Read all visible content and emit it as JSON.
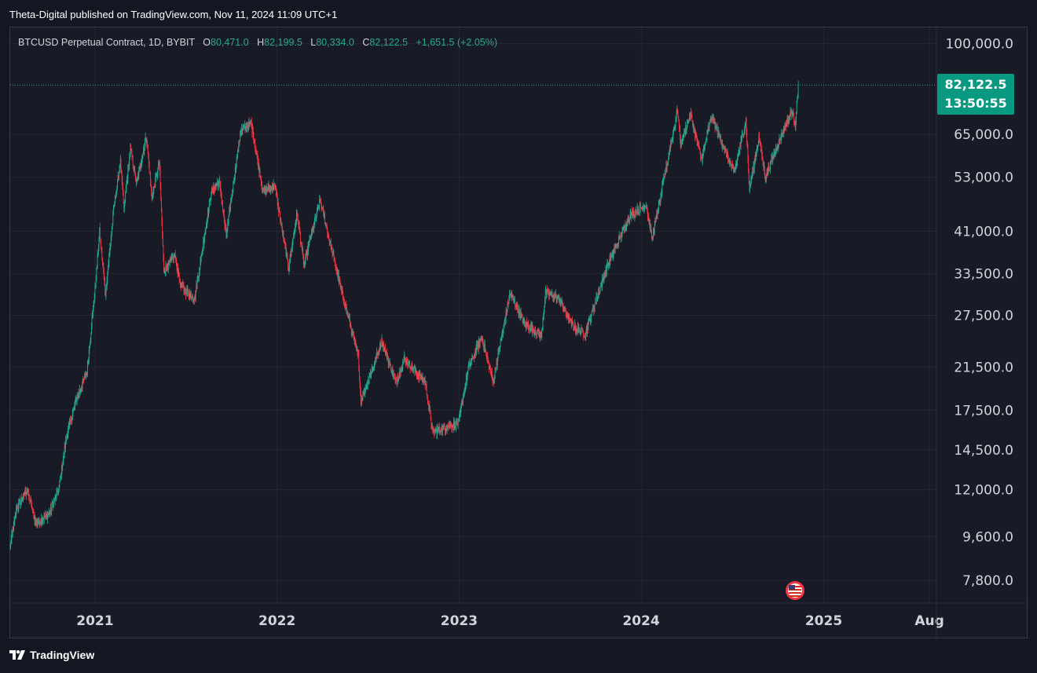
{
  "header": {
    "published_text": "Theta-Digital published on TradingView.com, Nov 11, 2024 11:09 UTC+1"
  },
  "legend": {
    "symbol": "BTCUSD Perpetual Contract, 1D, BYBIT",
    "open_label": "O",
    "open_value": "80,471.0",
    "high_label": "H",
    "high_value": "82,199.5",
    "low_label": "L",
    "low_value": "80,334.0",
    "close_label": "C",
    "close_value": "82,122.5",
    "change": "+1,651.5 (+2.05%)"
  },
  "price_tag": {
    "price": "82,122.5",
    "countdown": "13:50:55",
    "color": "#089981"
  },
  "footer": {
    "brand": "TradingView"
  },
  "colors": {
    "up": "#22ab94",
    "down": "#f23645",
    "background": "#181b25",
    "grid": "#232632",
    "axis_text": "#d1d4dc"
  },
  "chart_data": {
    "type": "candlestick",
    "title": "BTCUSD Perpetual Contract, 1D, BYBIT",
    "y_scale": "log",
    "ylim": [
      7000,
      108000
    ],
    "y_ticks": [
      {
        "value": 100000,
        "label": "100,000.0"
      },
      {
        "value": 65000,
        "label": "65,000.0"
      },
      {
        "value": 53000,
        "label": "53,000.0"
      },
      {
        "value": 41000,
        "label": "41,000.0"
      },
      {
        "value": 33500,
        "label": "33,500.0"
      },
      {
        "value": 27500,
        "label": "27,500.0"
      },
      {
        "value": 21500,
        "label": "21,500.0"
      },
      {
        "value": 17500,
        "label": "17,500.0"
      },
      {
        "value": 14500,
        "label": "14,500.0"
      },
      {
        "value": 12000,
        "label": "12,000.0"
      },
      {
        "value": 9600,
        "label": "9,600.0"
      },
      {
        "value": 7800,
        "label": "7,800.0"
      }
    ],
    "x_range": [
      "2020-07-15",
      "2025-08-15"
    ],
    "x_ticks": [
      {
        "date": "2021-01-01",
        "label": "2021"
      },
      {
        "date": "2022-01-01",
        "label": "2022"
      },
      {
        "date": "2023-01-01",
        "label": "2023"
      },
      {
        "date": "2024-01-01",
        "label": "2024"
      },
      {
        "date": "2025-01-01",
        "label": "2025"
      },
      {
        "date": "2025-08-01",
        "label": "Aug"
      }
    ],
    "last_price": 82122.5,
    "price_path": [
      [
        "2020-07-15",
        9200
      ],
      [
        "2020-07-28",
        11000
      ],
      [
        "2020-08-18",
        12000
      ],
      [
        "2020-09-05",
        10200
      ],
      [
        "2020-10-01",
        10700
      ],
      [
        "2020-10-20",
        12000
      ],
      [
        "2020-11-05",
        15500
      ],
      [
        "2020-11-25",
        18500
      ],
      [
        "2020-12-16",
        21000
      ],
      [
        "2021-01-02",
        32000
      ],
      [
        "2021-01-10",
        41000
      ],
      [
        "2021-01-22",
        30500
      ],
      [
        "2021-02-08",
        46000
      ],
      [
        "2021-02-21",
        57000
      ],
      [
        "2021-02-28",
        45500
      ],
      [
        "2021-03-13",
        61000
      ],
      [
        "2021-03-25",
        51500
      ],
      [
        "2021-04-14",
        64500
      ],
      [
        "2021-04-25",
        48000
      ],
      [
        "2021-05-10",
        57000
      ],
      [
        "2021-05-19",
        34000
      ],
      [
        "2021-06-10",
        36500
      ],
      [
        "2021-06-22",
        31500
      ],
      [
        "2021-07-20",
        29800
      ],
      [
        "2021-08-22",
        49500
      ],
      [
        "2021-09-07",
        52000
      ],
      [
        "2021-09-21",
        40000
      ],
      [
        "2021-10-20",
        66000
      ],
      [
        "2021-11-10",
        68500
      ],
      [
        "2021-12-04",
        49500
      ],
      [
        "2021-12-27",
        51000
      ],
      [
        "2022-01-24",
        34500
      ],
      [
        "2022-02-10",
        44500
      ],
      [
        "2022-02-24",
        35000
      ],
      [
        "2022-03-28",
        47500
      ],
      [
        "2022-05-10",
        31000
      ],
      [
        "2022-06-13",
        22500
      ],
      [
        "2022-06-18",
        18300
      ],
      [
        "2022-07-30",
        24300
      ],
      [
        "2022-08-27",
        20000
      ],
      [
        "2022-09-13",
        22400
      ],
      [
        "2022-10-25",
        20000
      ],
      [
        "2022-11-09",
        15800
      ],
      [
        "2022-12-31",
        16500
      ],
      [
        "2023-01-20",
        21500
      ],
      [
        "2023-02-16",
        24800
      ],
      [
        "2023-03-10",
        20000
      ],
      [
        "2023-04-13",
        30500
      ],
      [
        "2023-05-12",
        26500
      ],
      [
        "2023-06-15",
        25000
      ],
      [
        "2023-06-23",
        30600
      ],
      [
        "2023-07-20",
        29800
      ],
      [
        "2023-08-18",
        26000
      ],
      [
        "2023-09-11",
        25200
      ],
      [
        "2023-10-24",
        34500
      ],
      [
        "2023-12-08",
        44000
      ],
      [
        "2024-01-11",
        46500
      ],
      [
        "2024-01-23",
        39500
      ],
      [
        "2024-02-15",
        52000
      ],
      [
        "2024-03-14",
        73000
      ],
      [
        "2024-03-20",
        62000
      ],
      [
        "2024-04-09",
        71500
      ],
      [
        "2024-05-01",
        57500
      ],
      [
        "2024-05-21",
        71000
      ],
      [
        "2024-07-05",
        54000
      ],
      [
        "2024-07-29",
        69500
      ],
      [
        "2024-08-05",
        50000
      ],
      [
        "2024-08-24",
        64000
      ],
      [
        "2024-09-06",
        53000
      ],
      [
        "2024-10-15",
        67500
      ],
      [
        "2024-10-29",
        72500
      ],
      [
        "2024-11-05",
        68500
      ],
      [
        "2024-11-11",
        82122.5
      ]
    ]
  }
}
